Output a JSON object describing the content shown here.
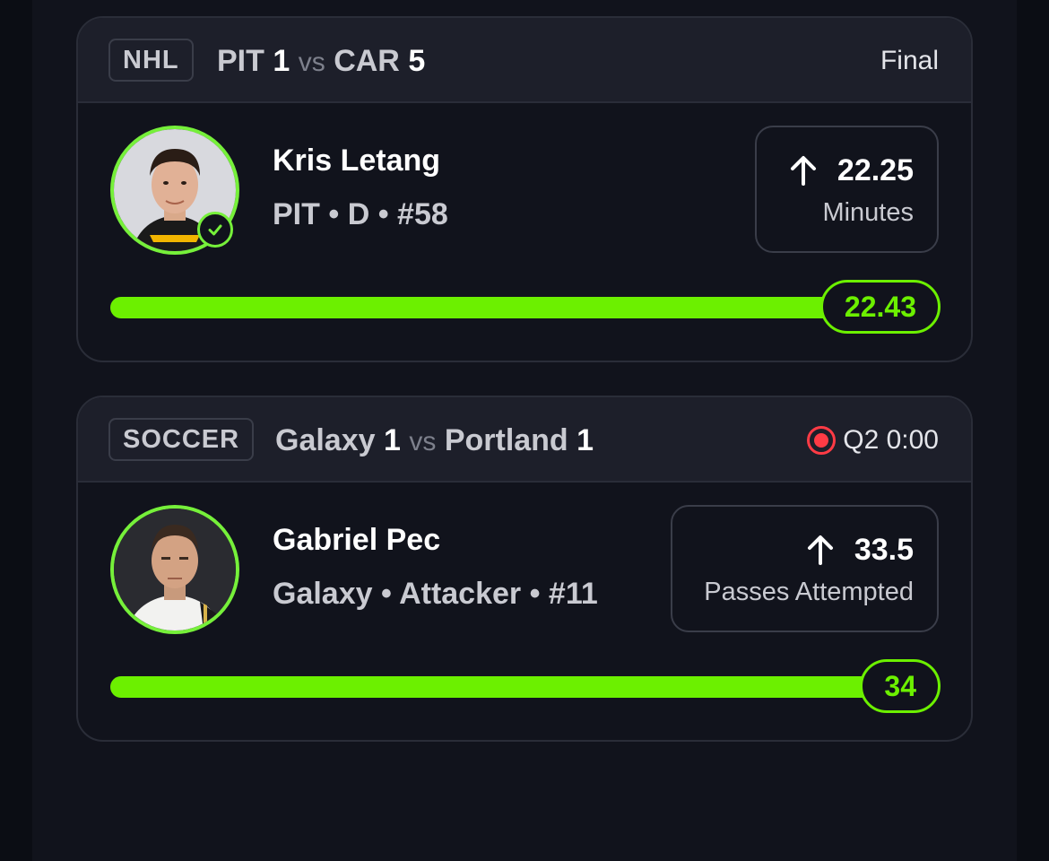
{
  "colors": {
    "background": "#11131c",
    "header": "#1d1f2a",
    "accent_green": "#6cf000",
    "live_red": "#ff3b45"
  },
  "cards": [
    {
      "league": "NHL",
      "team_a": "PIT",
      "score_a": "1",
      "vs": "vs",
      "team_b": "CAR",
      "score_b": "5",
      "status": "Final",
      "live": false,
      "player": {
        "name": "Kris Letang",
        "team": "PIT",
        "position": "D",
        "number": "#58",
        "meta": "PIT • D • #58",
        "verified": true
      },
      "line": {
        "direction_icon": "arrow-up-icon",
        "value": "22.25",
        "stat": "Minutes"
      },
      "result": {
        "value": "22.43",
        "progress": 1.0
      }
    },
    {
      "league": "SOCCER",
      "team_a": "Galaxy",
      "score_a": "1",
      "vs": "vs",
      "team_b": "Portland",
      "score_b": "1",
      "status": "Q2 0:00",
      "live": true,
      "player": {
        "name": "Gabriel Pec",
        "team": "Galaxy",
        "position": "Attacker",
        "number": "#11",
        "meta": "Galaxy • Attacker • #11",
        "verified": false
      },
      "line": {
        "direction_icon": "arrow-up-icon",
        "value": "33.5",
        "stat": "Passes Attempted"
      },
      "result": {
        "value": "34",
        "progress": 1.0
      }
    }
  ]
}
